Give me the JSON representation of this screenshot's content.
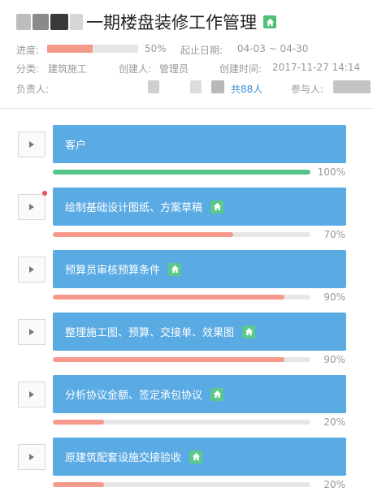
{
  "project": {
    "title": "一期楼盘装修工作管理",
    "progress_label": "进度:",
    "progress_value": 0.5,
    "progress_text": "50%",
    "date_label": "起止日期:",
    "date_value": "04-03 ~ 04-30",
    "category_label": "分类:",
    "category_value": "建筑施工",
    "creator_label": "创建人:",
    "creator_value": "管理员",
    "created_label": "创建时间:",
    "created_value": "2017-11-27 14:14",
    "owner_label": "负责人:",
    "owner_count": "共88人",
    "participant_label": "参与人:"
  },
  "colors": {
    "card": "#5aaae3",
    "green": "#52c48a",
    "salmon": "#f5998a",
    "link": "#3b8fd6"
  },
  "tasks": [
    {
      "label": "客户",
      "progress": 1.0,
      "pct_text": "100%",
      "color": "green",
      "has_home_icon": false,
      "has_notice": false
    },
    {
      "label": "绘制基础设计图纸、方案草稿",
      "progress": 0.7,
      "pct_text": "70%",
      "color": "salmon",
      "has_home_icon": true,
      "has_notice": true
    },
    {
      "label": "预算员审核预算条件",
      "progress": 0.9,
      "pct_text": "90%",
      "color": "salmon",
      "has_home_icon": true,
      "has_notice": false
    },
    {
      "label": "整理施工图、预算、交接单、效果图",
      "progress": 0.9,
      "pct_text": "90%",
      "color": "salmon",
      "has_home_icon": true,
      "has_notice": false
    },
    {
      "label": "分析协议金额、签定承包协议",
      "progress": 0.2,
      "pct_text": "20%",
      "color": "salmon",
      "has_home_icon": true,
      "has_notice": false
    },
    {
      "label": "原建筑配套设施交接验收",
      "progress": 0.2,
      "pct_text": "20%",
      "color": "salmon",
      "has_home_icon": true,
      "has_notice": false
    }
  ]
}
